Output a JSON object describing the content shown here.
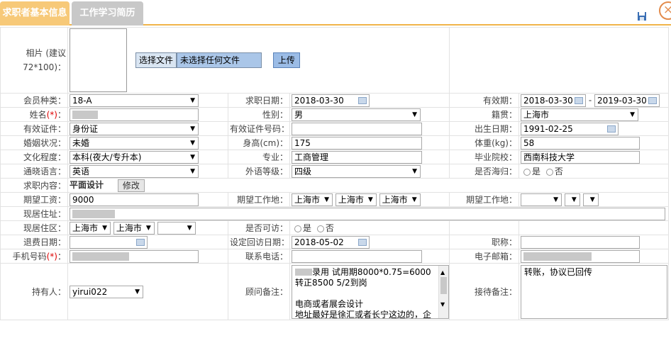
{
  "tabs": [
    {
      "label": "求职者基本信息"
    },
    {
      "label": "工作学习简历"
    }
  ],
  "photo": {
    "label": "相片 (建议72*100)：",
    "choose_file": "选择文件",
    "no_file": "未选择任何文件",
    "upload": "上传"
  },
  "row1": {
    "member_type_label": "会员种类：",
    "member_type": "18-A",
    "apply_date_label": "求职日期：",
    "apply_date": "2018-03-30",
    "validity_label": "有效期：",
    "validity_from": "2018-03-30",
    "validity_sep": "-",
    "validity_to": "2019-03-30"
  },
  "row2": {
    "name_label": "姓名",
    "name_req": "(*)",
    "name_colon": "：",
    "gender_label": "性别：",
    "gender": "男",
    "origin_label": "籍贯：",
    "origin": "上海市"
  },
  "row3": {
    "id_type_label": "有效证件：",
    "id_type": "身份证",
    "id_no_label": "有效证件号码：",
    "birth_label": "出生日期：",
    "birth": "1991-02-25"
  },
  "row4": {
    "marital_label": "婚姻状况：",
    "marital": "未婚",
    "height_label": "身高(cm)：",
    "height": "175",
    "weight_label": "体重(kg)：",
    "weight": "58"
  },
  "row5": {
    "edu_label": "文化程度：",
    "edu": "本科(夜大/专升本)",
    "major_label": "专业：",
    "major": "工商管理",
    "school_label": "毕业院校：",
    "school": "西南科技大学"
  },
  "row6": {
    "lang_label": "通晓语言：",
    "lang": "英语",
    "lang_level_label": "外语等级：",
    "lang_level": "四级",
    "overseas_label": "是否海归：",
    "yes": "是",
    "no": "否"
  },
  "row7": {
    "content_label": "求职内容：",
    "content": "平面设计",
    "modify": "修改"
  },
  "row8": {
    "salary_label": "期望工资：",
    "salary": "9000",
    "place_label": "期望工作地：",
    "place1": "上海市",
    "place2": "上海市",
    "place3": "上海市",
    "place2_label": "期望工作地："
  },
  "row9": {
    "addr_label": "现居住址："
  },
  "row10": {
    "area_label": "现居住区：",
    "area1": "上海市",
    "area2": "上海市",
    "visit_label": "是否可访：",
    "yes": "是",
    "no": "否"
  },
  "row11": {
    "refund_label": "退费日期：",
    "revisit_label": "设定回访日期：",
    "revisit": "2018-05-02",
    "title_label": "职称："
  },
  "row12": {
    "mobile_label": "手机号码",
    "mobile_req": "(*)",
    "mobile_colon": "：",
    "tel_label": "联系电话：",
    "email_label": "电子邮箱："
  },
  "row13": {
    "holder_label": "持有人：",
    "holder": "yirui022",
    "consult_label": "顾问备注：",
    "consult_l1": "录用 试用期8000*0.75=6000 转正8500  5/2到岗",
    "consult_l2": "电商或者展会设计",
    "consult_l3": "地址最好是徐汇或者长宁这边的，企",
    "reception_label": "接待备注：",
    "reception": "转账，协议已回传"
  }
}
